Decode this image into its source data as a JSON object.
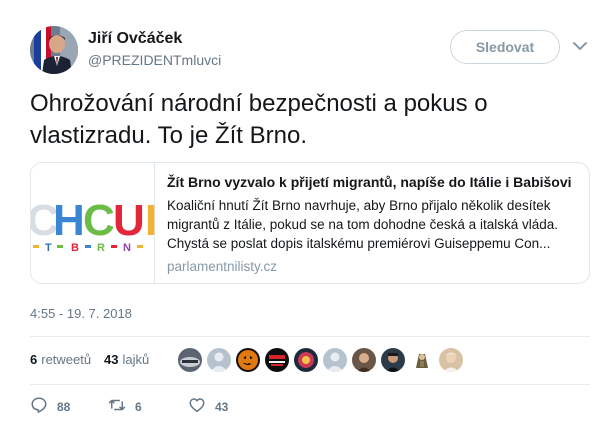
{
  "user": {
    "name": "Jiří Ovčáček",
    "handle": "@PREZIDENTmluvci"
  },
  "header": {
    "follow_label": "Sledovat"
  },
  "tweet": {
    "line1": "Ohrožování národní bezpečnosti a pokus o",
    "line2": "vlastizradu. To je Žít Brno."
  },
  "card": {
    "image_text": "CHCU",
    "image_sub": "T B R N",
    "title": "Žít Brno vyzvalo k přijetí migrantů, napíše do Itálie i Babišovi",
    "desc_line1": "Koaliční hnutí Žít Brno navrhuje, aby Brno přijalo několik desítek",
    "desc_line2": "migrantů z Itálie, pokud se na tom dohodne česká a italská vláda.",
    "desc_line3": "Chystá se poslat dopis italskému premiérovi Guiseppemu Con...",
    "domain": "parlamentnilisty.cz"
  },
  "meta": {
    "timestamp": "4:55 - 19. 7. 2018"
  },
  "stats": {
    "retweets_count": "6",
    "retweets_label": "retweetů",
    "likes_count": "43",
    "likes_label": "lajků"
  },
  "actions": {
    "replies": "88",
    "retweets": "6",
    "likes": "43"
  },
  "colors": {
    "text": "#14171a",
    "muted": "#657786",
    "border": "#e1e8ed",
    "follow_border": "#ccd6dd"
  }
}
